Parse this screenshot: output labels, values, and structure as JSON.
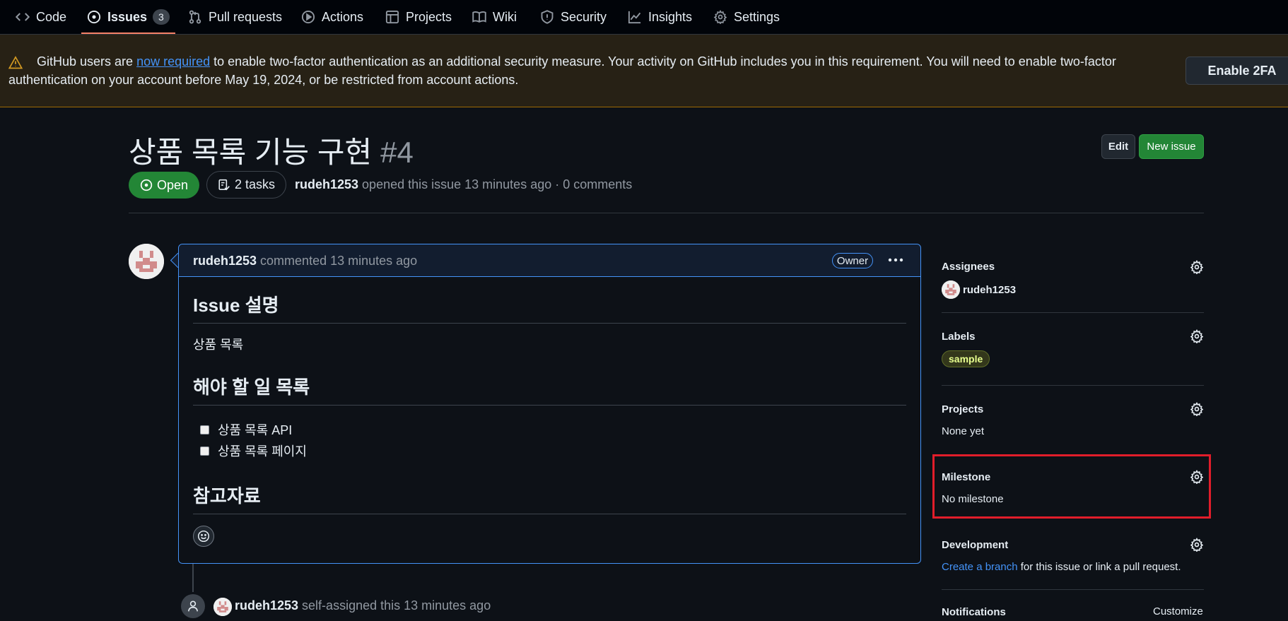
{
  "nav": {
    "items": [
      {
        "label": "Code",
        "icon": "code-icon"
      },
      {
        "label": "Issues",
        "icon": "issue-opened-icon",
        "count": "3",
        "selected": true
      },
      {
        "label": "Pull requests",
        "icon": "git-pull-request-icon"
      },
      {
        "label": "Actions",
        "icon": "play-icon"
      },
      {
        "label": "Projects",
        "icon": "table-icon"
      },
      {
        "label": "Wiki",
        "icon": "book-icon"
      },
      {
        "label": "Security",
        "icon": "shield-icon"
      },
      {
        "label": "Insights",
        "icon": "graph-icon"
      },
      {
        "label": "Settings",
        "icon": "gear-icon"
      }
    ]
  },
  "banner": {
    "text_before": "GitHub users are ",
    "link_text": "now required",
    "text_after": " to enable two-factor authentication as an additional security measure. Your activity on GitHub includes you in this requirement. You will need to enable two-factor authentication on your account before May 19, 2024, or be restricted from account actions.",
    "button_label": "Enable 2FA",
    "accent": "#d29922"
  },
  "issue": {
    "title": "상품 목록 기능 구현",
    "number": "#4",
    "edit_label": "Edit",
    "new_issue_label": "New issue",
    "state": "Open",
    "tasks": "2 tasks",
    "author": "rudeh1253",
    "meta": " opened this issue 13 minutes ago · 0 comments"
  },
  "comment": {
    "author": "rudeh1253",
    "action": " commented 13 minutes ago",
    "badge": "Owner",
    "h_description": "Issue 설명",
    "description": "상품 목록",
    "h_todo": "해야 할 일 목록",
    "tasks": [
      "상품 목록 API",
      "상품 목록 페이지"
    ],
    "h_refs": "참고자료"
  },
  "timeline": {
    "author": "rudeh1253",
    "event": " self-assigned this 13 minutes ago"
  },
  "sidebar": {
    "assignees": {
      "heading": "Assignees",
      "user": "rudeh1253"
    },
    "labels": {
      "heading": "Labels",
      "label": "sample"
    },
    "projects": {
      "heading": "Projects",
      "value": "None yet"
    },
    "milestone": {
      "heading": "Milestone",
      "value": "No milestone"
    },
    "development": {
      "heading": "Development",
      "link": "Create a branch",
      "rest": " for this issue or link a pull request."
    },
    "notifications": {
      "heading": "Notifications",
      "customize": "Customize"
    }
  },
  "colors": {
    "background": "#0d1117",
    "open_green": "#238636",
    "accent_blue": "#4493f8",
    "highlight_red": "#e11d2a"
  }
}
